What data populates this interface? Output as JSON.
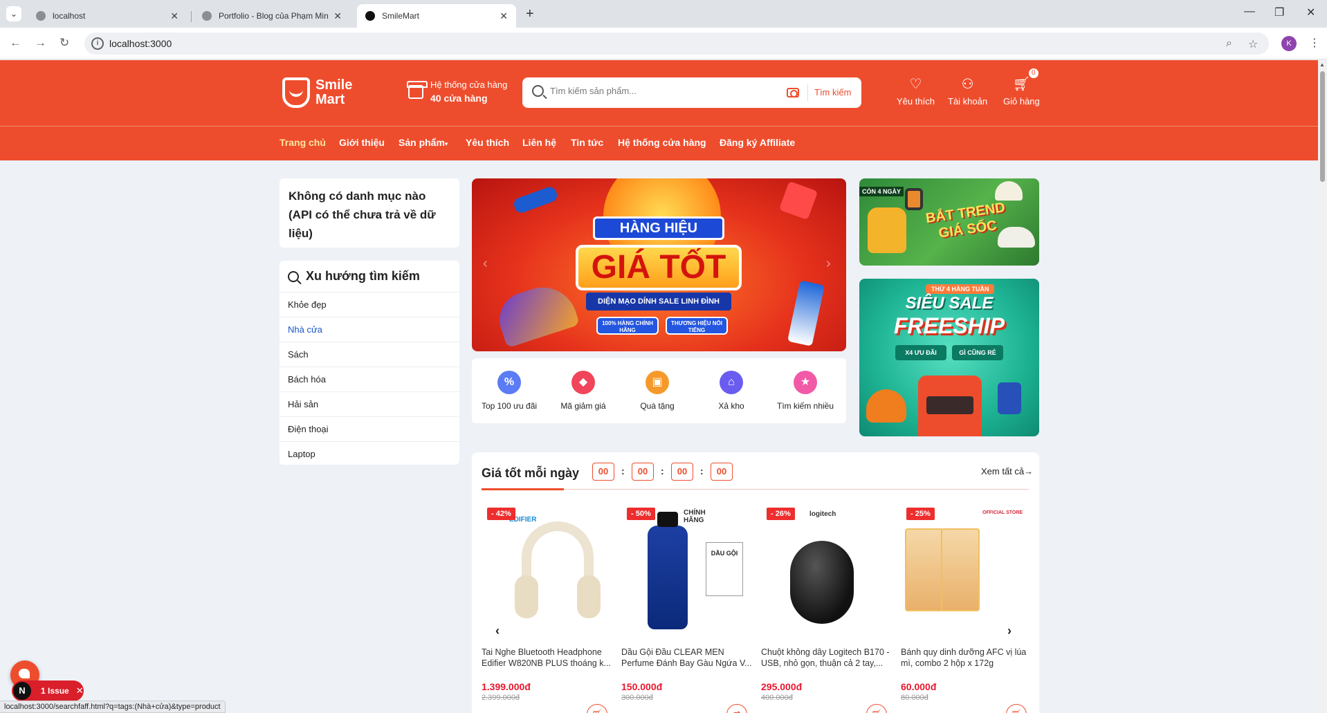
{
  "browser": {
    "tabs": [
      {
        "title": "localhost"
      },
      {
        "title": "Portfolio - Blog của Phạm Minh"
      },
      {
        "title": "SmileMart"
      }
    ],
    "url": "localhost:3000",
    "profile_initial": "K"
  },
  "header": {
    "logo_line1": "Smile",
    "logo_line2": "Mart",
    "store_label": "Hệ thống cửa hàng",
    "store_count": "40 cửa hàng",
    "search_placeholder": "Tìm kiếm sản phẩm...",
    "search_button": "Tìm kiếm",
    "wishlist": "Yêu thích",
    "account": "Tài khoản",
    "cart": "Giỏ hàng",
    "cart_count": "0"
  },
  "nav": [
    {
      "label": "Trang chủ"
    },
    {
      "label": "Giới thiệu"
    },
    {
      "label": "Sản phẩm"
    },
    {
      "label": "Yêu thích"
    },
    {
      "label": "Liên hệ"
    },
    {
      "label": "Tin tức"
    },
    {
      "label": "Hệ thống cửa hàng"
    },
    {
      "label": "Đăng ký Affiliate"
    }
  ],
  "sidebar": {
    "no_category": "Không có danh mục nào (API có thể chưa trả về dữ liệu)",
    "trend_title": "Xu hướng tìm kiếm",
    "trends": [
      {
        "label": "Khỏe đẹp"
      },
      {
        "label": "Nhà cửa"
      },
      {
        "label": "Sách"
      },
      {
        "label": "Bách hóa"
      },
      {
        "label": "Hải sản"
      },
      {
        "label": "Điện thoại"
      },
      {
        "label": "Laptop"
      }
    ]
  },
  "hero": {
    "ribbon": "HÀNG HIỆU",
    "headline": "GIÁ TỐT",
    "subline": "DIỆN MẠO DÍNH SALE LINH ĐÌNH",
    "pill1": "100% HÀNG CHÍNH HÃNG",
    "pill2": "THƯƠNG HIỆU NỔI TIẾNG"
  },
  "side_banner_1": {
    "tag": "CÒN 4 NGÀY",
    "title": "BẮT TREND GIÁ SỐC"
  },
  "side_banner_2": {
    "week": "THỨ 4 HÀNG TUẦN",
    "line1": "SIÊU SALE",
    "line2": "FREESHIP",
    "chip1": "X4 ƯU ĐÃI",
    "chip2": "GÌ CŨNG RẺ"
  },
  "quick_links": [
    {
      "label": "Top 100 ưu đãi",
      "icon": "percent-icon",
      "color": "#5b7cf5"
    },
    {
      "label": "Mã giảm giá",
      "icon": "coupon-icon",
      "color": "#f0455a"
    },
    {
      "label": "Quà tặng",
      "icon": "gift-icon",
      "color": "#f59a2a"
    },
    {
      "label": "Xả kho",
      "icon": "store-icon",
      "color": "#6b5cf0"
    },
    {
      "label": "Tìm kiếm nhiều",
      "icon": "search-star-icon",
      "color": "#f25aa8"
    }
  ],
  "flash_sale": {
    "title": "Giá tốt mỗi ngày",
    "countdown": [
      "00",
      "00",
      "00",
      "00"
    ],
    "view_all": "Xem tất cả"
  },
  "products": [
    {
      "discount": "- 42%",
      "name": "Tai Nghe Bluetooth Headphone Edifier W820NB PLUS thoáng k...",
      "price": "1.399.000đ",
      "old_price": "2.399.000đ",
      "brand": "EDIFIER"
    },
    {
      "discount": "- 50%",
      "name": "Dầu Gội Đầu CLEAR MEN Perfume Đánh Bay Gàu Ngứa V...",
      "price": "150.000đ",
      "old_price": "300.000đ",
      "brand": "CHÍNH HÃNG",
      "box": "DẦU GỘI"
    },
    {
      "discount": "- 26%",
      "name": "Chuột không dây Logitech B170 - USB, nhỏ gọn, thuận cả 2 tay,...",
      "price": "295.000đ",
      "old_price": "400.000đ",
      "brand": "logitech"
    },
    {
      "discount": "- 25%",
      "name": "Bánh quy dinh dưỡng AFC vị lúa mì, combo 2 hộp x 172g",
      "price": "60.000đ",
      "old_price": "80.000đ",
      "brand": "OFFICIAL STORE"
    }
  ],
  "devtools": {
    "n": "N",
    "issue": "1 Issue"
  },
  "status_url": "localhost:3000/searchfaff.html?q=tags:(Nhà+cửa)&type=product",
  "colors": {
    "brand": "#ee4d2d",
    "price": "#e8172d",
    "link": "#1a56c4"
  }
}
